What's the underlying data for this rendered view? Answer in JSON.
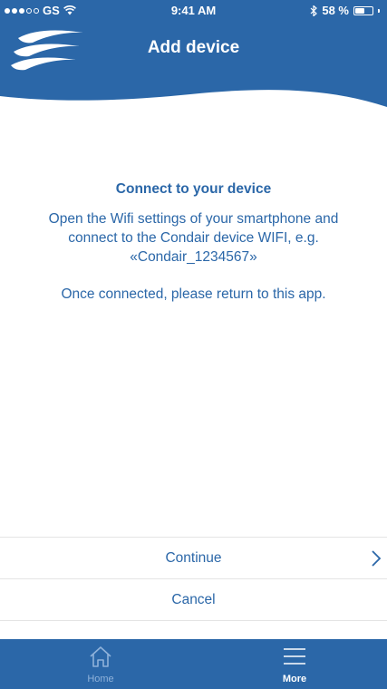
{
  "status_bar": {
    "carrier": "GS",
    "time": "9:41 AM",
    "battery": "58 %",
    "battery_level": 0.58
  },
  "header": {
    "title": "Add device",
    "logo_icon": "condair-wave-logo-icon"
  },
  "main": {
    "heading": "Connect to your device",
    "instructions": "Open the Wifi settings of your smartphone and connect to the Condair device WIFI, e.g. «Condair_1234567»",
    "note": "Once connected, please return to this app."
  },
  "actions": {
    "continue_label": "Continue",
    "cancel_label": "Cancel"
  },
  "tabbar": {
    "home_label": "Home",
    "more_label": "More",
    "active_tab": "More"
  },
  "colors": {
    "brand_blue": "#2b67a8",
    "text_blue": "#2b67a8",
    "inactive_tab": "#8fb2da",
    "divider": "#e4e4e4",
    "background": "#ffffff"
  }
}
